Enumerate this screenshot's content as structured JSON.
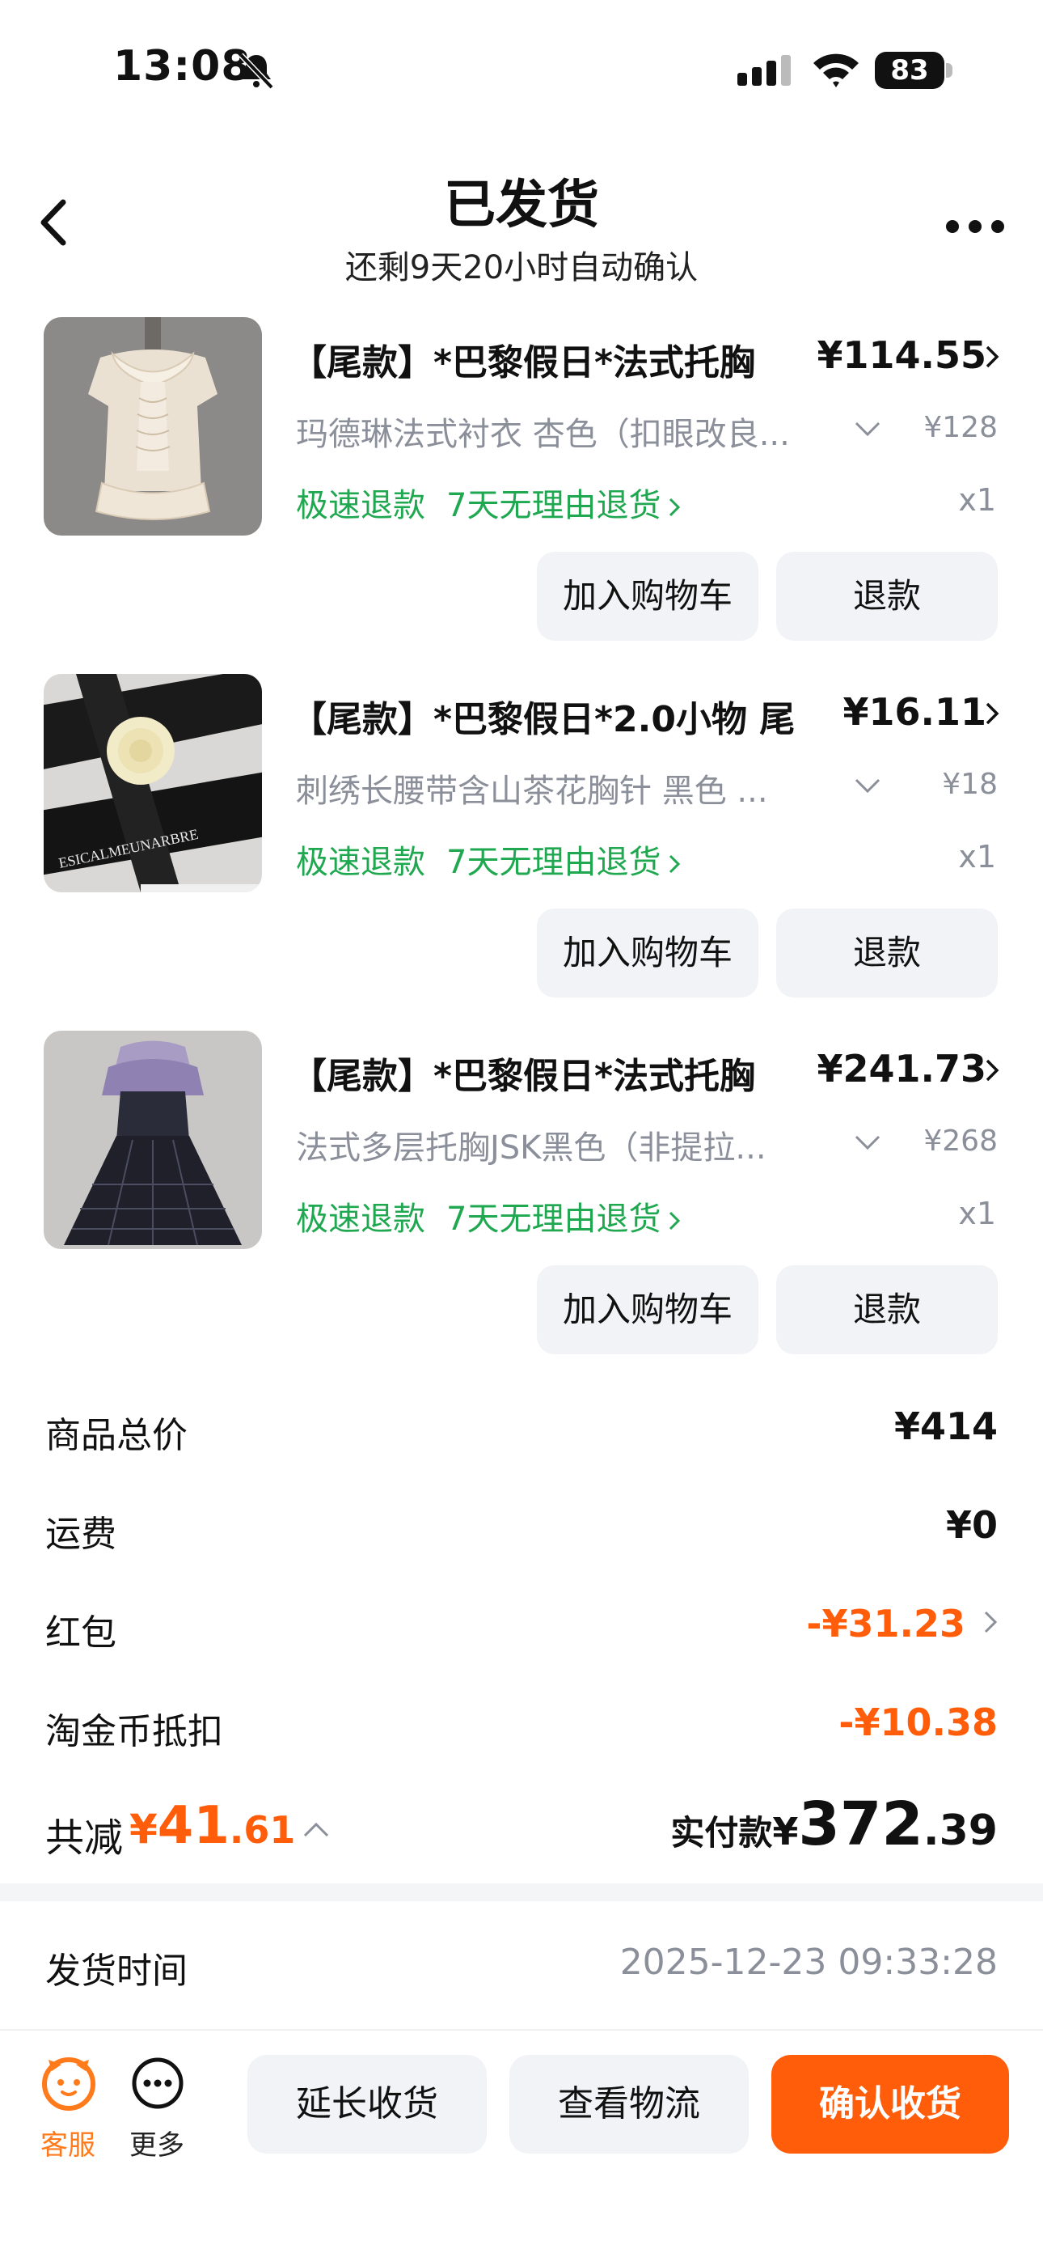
{
  "status_bar": {
    "time": "13:08",
    "battery": "83"
  },
  "nav": {
    "title": "已发货",
    "subtitle": "还剩9天20小时自动确认"
  },
  "items": [
    {
      "title": "【尾款】*巴黎假日*法式托胸",
      "price": "¥114.55",
      "spec": "玛德琳法式衬衣 杏色（扣眼改良...",
      "original_price": "¥128",
      "tag_fast_refund": "极速退款",
      "tag_return": "7天无理由退货",
      "qty": "x1",
      "btn_cart": "加入购物车",
      "btn_refund": "退款"
    },
    {
      "title": "【尾款】*巴黎假日*2.0小物 尾",
      "price": "¥16.11",
      "spec": "刺绣长腰带含山茶花胸针 黑色 ...",
      "original_price": "¥18",
      "tag_fast_refund": "极速退款",
      "tag_return": "7天无理由退货",
      "qty": "x1",
      "btn_cart": "加入购物车",
      "btn_refund": "退款"
    },
    {
      "title": "【尾款】*巴黎假日*法式托胸",
      "price": "¥241.73",
      "spec": "法式多层托胸JSK黑色（非提拉...",
      "original_price": "¥268",
      "tag_fast_refund": "极速退款",
      "tag_return": "7天无理由退货",
      "qty": "x1",
      "btn_cart": "加入购物车",
      "btn_refund": "退款"
    }
  ],
  "summary": {
    "goods_total_label": "商品总价",
    "goods_total": "¥414",
    "shipping_label": "运费",
    "shipping": "¥0",
    "red_packet_label": "红包",
    "red_packet": "-¥31.23",
    "coins_label": "淘金币抵扣",
    "coins": "-¥10.38",
    "saved_label": "共减",
    "saved_currency": "¥",
    "saved_int": "41",
    "saved_dec": ".61",
    "paid_label": "实付款",
    "paid_currency": "¥",
    "paid_int": "372",
    "paid_dec": ".39"
  },
  "shipping_info": {
    "label": "发货时间",
    "value": "2025-12-23 09:33:28"
  },
  "bottom_bar": {
    "service_label": "客服",
    "more_label": "更多",
    "extend_label": "延长收货",
    "track_label": "查看物流",
    "confirm_label": "确认收货"
  },
  "colors": {
    "accent": "#ff5d0a",
    "green_tag": "#1fa850",
    "muted": "#8b8f9a",
    "button_bg": "#f1f3f6"
  }
}
